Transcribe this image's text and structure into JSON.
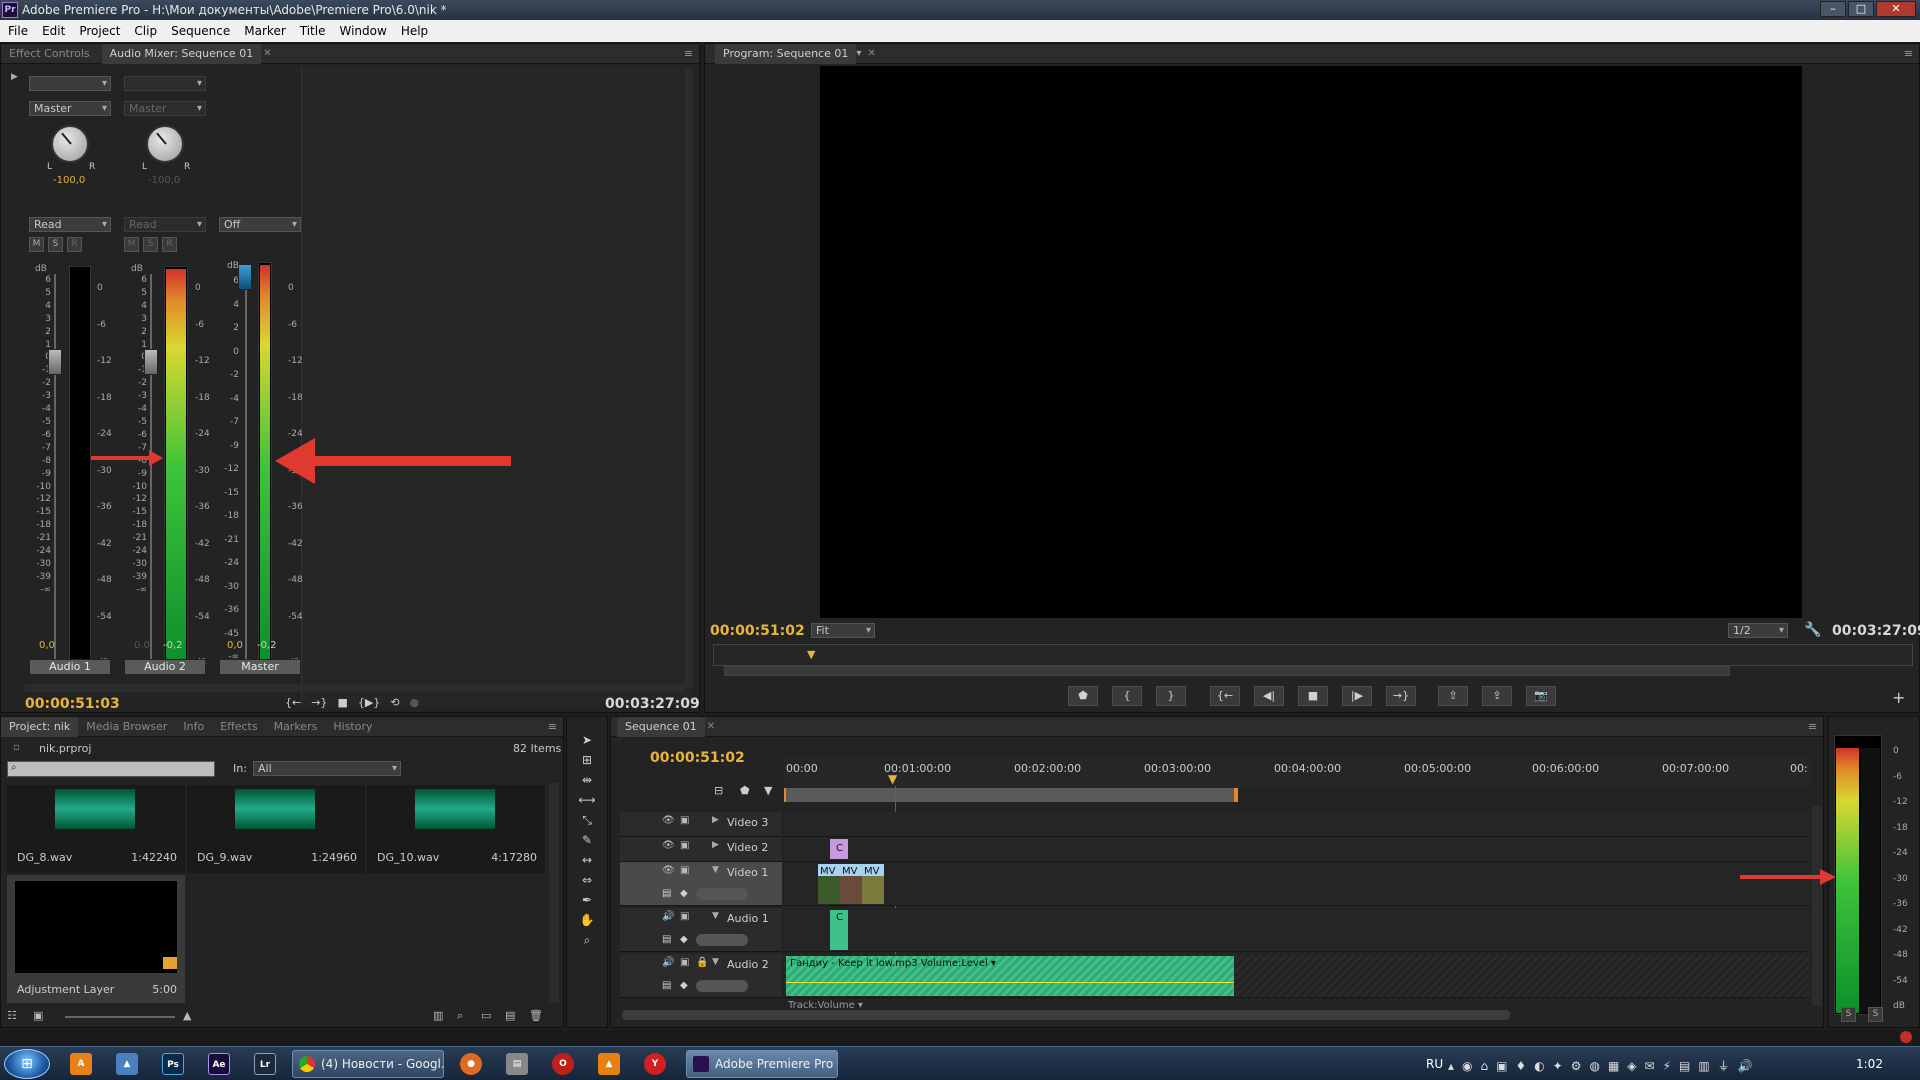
{
  "app": {
    "title": "Adobe Premiere Pro - H:\\Мои документы\\Adobe\\Premiere Pro\\6.0\\nik *",
    "logo": "Pr"
  },
  "menu": [
    "File",
    "Edit",
    "Project",
    "Clip",
    "Sequence",
    "Marker",
    "Title",
    "Window",
    "Help"
  ],
  "audio_mixer": {
    "tabs": [
      "Effect Controls",
      "Audio Mixer: Sequence 01"
    ],
    "channels": [
      {
        "output": "Master",
        "pan_value": "-100,0",
        "automation": "Read",
        "level_l": "0,0",
        "level_r": "",
        "name": "Audio 1",
        "m": "M",
        "s": "S",
        "r": "R"
      },
      {
        "output": "Master",
        "pan_value": "-100,0",
        "automation": "Read",
        "level_l": "0,0",
        "level_r": "-0,2",
        "name": "Audio 2",
        "m": "M",
        "s": "S",
        "r": "R"
      },
      {
        "output": "",
        "pan_value": "",
        "automation": "Off",
        "level_l": "0,0",
        "level_r": "-0,2",
        "name": "Master"
      }
    ],
    "fader_scale": [
      "6",
      "5",
      "4",
      "3",
      "2",
      "1",
      "0",
      "-1",
      "-2",
      "-3",
      "-4",
      "-5",
      "-6",
      "-7",
      "-8",
      "-9",
      "-10",
      "-12",
      "-15",
      "-18",
      "-21",
      "-24",
      "-30",
      "-39",
      "-∞"
    ],
    "meter_scale": [
      "0",
      "-6",
      "-12",
      "-18",
      "-24",
      "-30",
      "-36",
      "-42",
      "-48",
      "-54"
    ],
    "db": "dB",
    "current_time": "00:00:51:03",
    "duration": "00:03:27:09",
    "master_scale": [
      "6",
      "4",
      "2",
      "0",
      "-2",
      "-4",
      "-7",
      "-9",
      "-12",
      "-15",
      "-18",
      "-21",
      "-24",
      "-30",
      "-36",
      "-45",
      "-∞"
    ]
  },
  "program": {
    "tab": "Program: Sequence 01",
    "current_time": "00:00:51:02",
    "fit": "Fit",
    "resolution": "1/2",
    "duration": "00:03:27:09"
  },
  "project": {
    "tabs": [
      "Project: nik",
      "Media Browser",
      "Info",
      "Effects",
      "Markers",
      "History"
    ],
    "file": "nik.prproj",
    "count": "82 Items",
    "in_label": "In:",
    "in_value": "All",
    "items": [
      {
        "name": "DG_8.wav",
        "duration": "1:42240"
      },
      {
        "name": "DG_9.wav",
        "duration": "1:24960"
      },
      {
        "name": "DG_10.wav",
        "duration": "4:17280"
      },
      {
        "name": "Adjustment Layer",
        "duration": "5:00"
      }
    ]
  },
  "sequence": {
    "tab": "Sequence 01",
    "current_time": "00:00:51:02",
    "ruler": [
      "00:00",
      "00:01:00:00",
      "00:02:00:00",
      "00:03:00:00",
      "00:04:00:00",
      "00:05:00:00",
      "00:06:00:00",
      "00:07:00:00",
      "00:"
    ],
    "tracks": [
      {
        "name": "Video 3"
      },
      {
        "name": "Video 2"
      },
      {
        "name": "Video 1"
      },
      {
        "name": "Audio 1"
      },
      {
        "name": "Audio 2"
      }
    ],
    "clip_labels": {
      "mv1": "MV",
      "mv2": "MV",
      "mv3": "MV",
      "c": "C",
      "audio2": "Гандиу - Keep it low.mp3  Volume:Level ▾",
      "track_volume": "Track:Volume ▾"
    }
  },
  "master_meter": {
    "scale": [
      "0",
      "-6",
      "-12",
      "-18",
      "-24",
      "-30",
      "-36",
      "-42",
      "-48",
      "-54",
      "dB"
    ],
    "s1": "S",
    "s2": "S"
  },
  "taskbar": {
    "tasks": [
      {
        "label": "(4) Новости - Googl..."
      },
      {
        "label": "Adobe Premiere Pro ..."
      }
    ],
    "lang": "RU",
    "clock": "1:02"
  },
  "colors": {
    "accent_timecode": "#e8b53a",
    "meter_green": "#40c33a",
    "arrow_red": "#e03a30",
    "audio_clip": "#3ec28a"
  }
}
